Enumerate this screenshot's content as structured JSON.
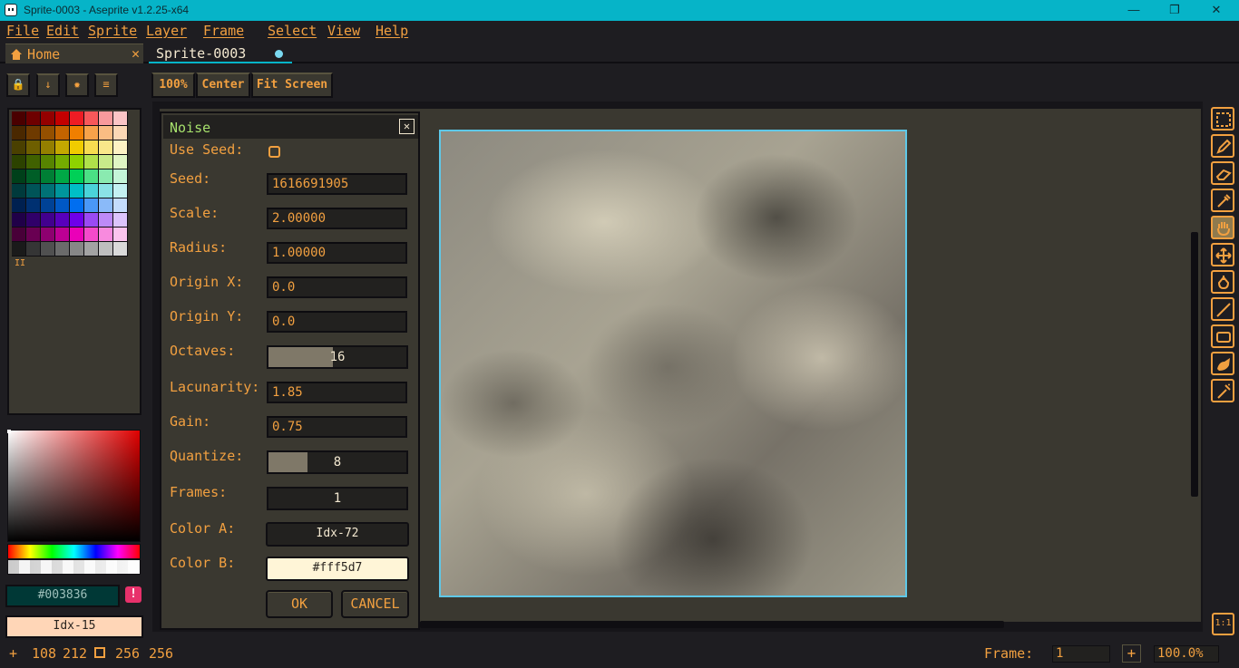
{
  "window": {
    "title": "Sprite-0003 - Aseprite v1.2.25-x64",
    "minimize": "—",
    "maximize": "❐",
    "close": "✕"
  },
  "menu": [
    "File",
    "Edit",
    "Sprite",
    "Layer",
    "Frame",
    "Select",
    "View",
    "Help"
  ],
  "tabs": {
    "home": "Home",
    "home_close": "✕",
    "sprite": "Sprite-0003"
  },
  "left_toolbar": {
    "lock": "🔒",
    "down": "↓",
    "options": "✹",
    "menu": "≡"
  },
  "palette": {
    "swatches": [
      "#4a0000",
      "#6e0000",
      "#940000",
      "#c40000",
      "#ee1c24",
      "#f7585a",
      "#f89a9c",
      "#fcc5c6",
      "#4a2800",
      "#6e3a00",
      "#945000",
      "#c46400",
      "#f07f00",
      "#f7a24a",
      "#f9bd83",
      "#fcd8b5",
      "#4a4000",
      "#6e5f00",
      "#947f00",
      "#c4a800",
      "#f0cc00",
      "#f7dc50",
      "#f9e78a",
      "#fdf2c4",
      "#2c4200",
      "#406100",
      "#578400",
      "#74ac00",
      "#8ed200",
      "#b0e04a",
      "#c8ea8a",
      "#e0f5c4",
      "#00401a",
      "#005e27",
      "#007f35",
      "#00a846",
      "#00d057",
      "#4ae085",
      "#8aeab0",
      "#c4f5d8",
      "#003a3c",
      "#005458",
      "#007276",
      "#00969c",
      "#00bec6",
      "#4ad3d9",
      "#8ae2e6",
      "#c4f1f2",
      "#002050",
      "#003071",
      "#004296",
      "#0058c4",
      "#006ef0",
      "#4a98f7",
      "#8abaf9",
      "#c4dcfc",
      "#200048",
      "#300069",
      "#42008e",
      "#5800bc",
      "#6e00ea",
      "#9a4af4",
      "#bd8af8",
      "#dcc4fc",
      "#480038",
      "#690052",
      "#8e0070",
      "#bc0094",
      "#ea00b8",
      "#f44acb",
      "#f88ade",
      "#fcc4ee",
      "#1a1a1a",
      "#353535",
      "#505050",
      "#6b6b6b",
      "#878787",
      "#a3a3a3",
      "#bebebe",
      "#dadada"
    ],
    "grip": "II"
  },
  "colors": {
    "foreground": "#003836",
    "warn": "!",
    "background": "Idx-15"
  },
  "zoom_buttons": [
    "100%",
    "Center",
    "Fit Screen"
  ],
  "dialog": {
    "title": "Noise",
    "close": "✕",
    "use_seed_label": "Use Seed:",
    "seed_label": "Seed:",
    "seed": "1616691905",
    "scale_label": "Scale:",
    "scale": "2.00000",
    "radius_label": "Radius:",
    "radius": "1.00000",
    "origin_x_label": "Origin X:",
    "origin_x": "0.0",
    "origin_y_label": "Origin Y:",
    "origin_y": "0.0",
    "octaves_label": "Octaves:",
    "octaves": "16",
    "octaves_level": 0.47,
    "lacunarity_label": "Lacunarity:",
    "lacunarity": "1.85",
    "gain_label": "Gain:",
    "gain": "0.75",
    "quantize_label": "Quantize:",
    "quantize": "8",
    "quantize_level": 0.28,
    "frames_label": "Frames:",
    "frames": "1",
    "color_a_label": "Color A:",
    "color_a": "Idx-72",
    "color_b_label": "Color B:",
    "color_b": "#fff5d7",
    "ok": "OK",
    "cancel": "CANCEL"
  },
  "status": {
    "cursor_icon": "+",
    "pos_x": "108",
    "pos_y": "212",
    "size_w": "256",
    "size_h": "256",
    "frame_label": "Frame:",
    "frame": "1",
    "plus": "+",
    "zoom": "100.0%",
    "ratio": "1:1"
  },
  "tools": [
    "rectangular-marquee",
    "pencil",
    "eraser",
    "eyedropper",
    "hand",
    "move",
    "paint-bucket",
    "line",
    "rectangle",
    "blur",
    "spray"
  ]
}
